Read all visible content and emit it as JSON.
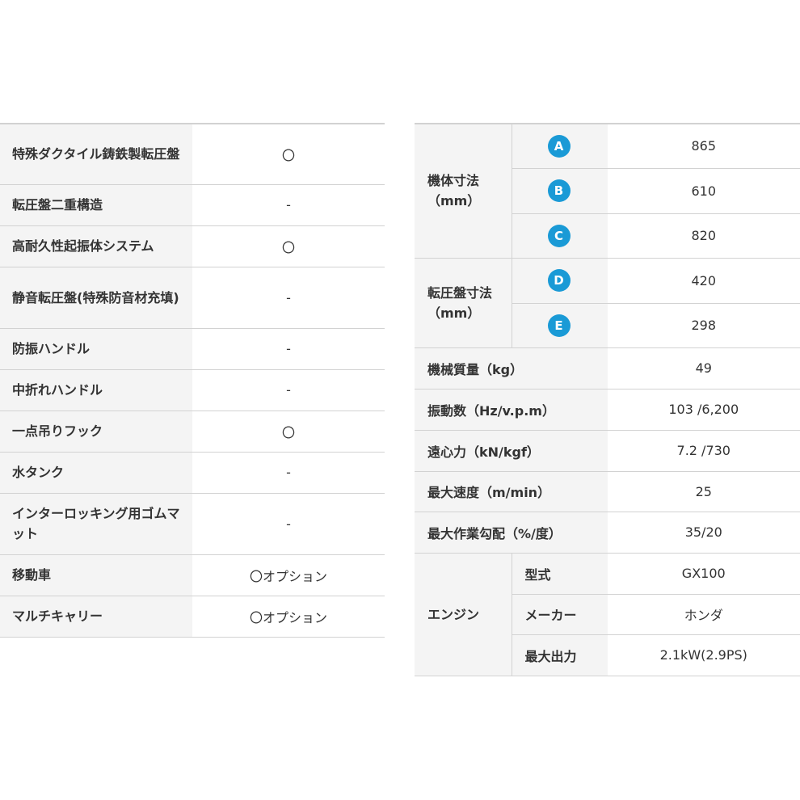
{
  "left_rows": [
    {
      "label": "特殊ダクタイル鋳鉄製転圧盤",
      "value": "〇"
    },
    {
      "label": "転圧盤二重構造",
      "value": "-"
    },
    {
      "label": "高耐久性起振体システム",
      "value": "〇"
    },
    {
      "label": "静音転圧盤(特殊防音材充填)",
      "value": "-"
    },
    {
      "label": "防振ハンドル",
      "value": "-"
    },
    {
      "label": "中折れハンドル",
      "value": "-"
    },
    {
      "label": "一点吊りフック",
      "value": "〇"
    },
    {
      "label": "水タンク",
      "value": "-"
    },
    {
      "label": "インターロッキング用ゴムマット",
      "value": "-"
    },
    {
      "label": "移動車",
      "value": "〇オプション"
    },
    {
      "label": "マルチキャリー",
      "value": "〇オプション"
    }
  ],
  "dims_group": {
    "label": "機体寸法（mm）",
    "rows": [
      {
        "badge": "A",
        "value": "865"
      },
      {
        "badge": "B",
        "value": "610"
      },
      {
        "badge": "C",
        "value": "820"
      }
    ]
  },
  "plate_group": {
    "label": "転圧盤寸法（mm）",
    "rows": [
      {
        "badge": "D",
        "value": "420"
      },
      {
        "badge": "E",
        "value": "298"
      }
    ]
  },
  "specs": [
    {
      "label": "機械質量（kg）",
      "value": "49"
    },
    {
      "label": "振動数（Hz/v.p.m）",
      "value": "103 /6,200"
    },
    {
      "label": "遠心力（kN/kgf）",
      "value": "7.2 /730"
    },
    {
      "label": "最大速度（m/min）",
      "value": "25"
    },
    {
      "label": "最大作業勾配（%/度）",
      "value": "35/20"
    }
  ],
  "engine_group": {
    "label": "エンジン",
    "rows": [
      {
        "label": "型式",
        "value": "GX100"
      },
      {
        "label": "メーカー",
        "value": "ホンダ"
      },
      {
        "label": "最大出力",
        "value": "2.1kW(2.9PS)"
      }
    ]
  },
  "colors": {
    "badge": "#1a9ad6",
    "label_bg": "#f4f4f4",
    "border": "#d2d2d2"
  }
}
